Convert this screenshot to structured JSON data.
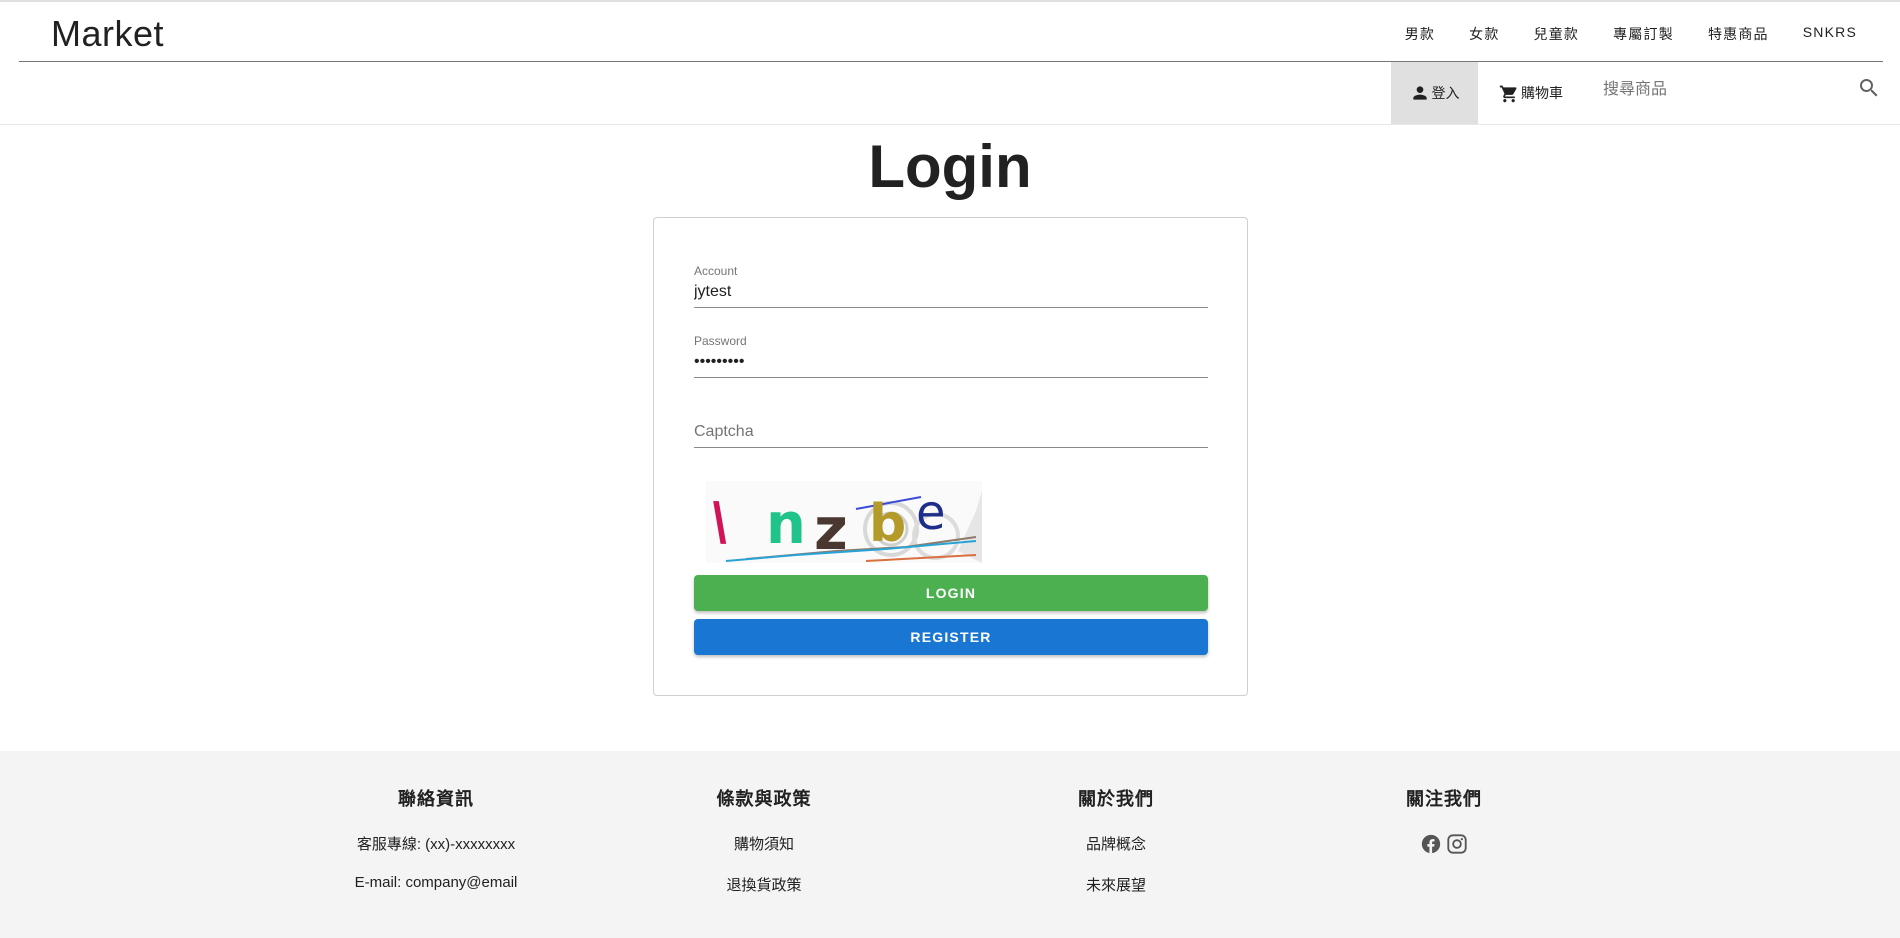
{
  "header": {
    "brand": "Market",
    "nav": [
      "男款",
      "女款",
      "兒童款",
      "專屬訂製",
      "特惠商品",
      "SNKRS"
    ]
  },
  "subbar": {
    "login_label": "登入",
    "cart_label": "購物車",
    "search_placeholder": "搜尋商品"
  },
  "page": {
    "title": "Login"
  },
  "form": {
    "account_label": "Account",
    "account_value": "jytest",
    "password_label": "Password",
    "password_value": "jytest123",
    "captcha_placeholder": "Captcha",
    "captcha_text": "Vnzbe",
    "login_button": "LOGIN",
    "register_button": "REGISTER"
  },
  "footer": {
    "contact": {
      "title": "聯絡資訊",
      "items": [
        "客服專線: (xx)-xxxxxxxx",
        "E-mail: company@email"
      ]
    },
    "policy": {
      "title": "條款與政策",
      "items": [
        "購物須知",
        "退換貨政策"
      ]
    },
    "about": {
      "title": "關於我們",
      "items": [
        "品牌概念",
        "未來展望"
      ]
    },
    "follow": {
      "title": "關注我們",
      "icons": [
        "facebook-icon",
        "instagram-icon"
      ]
    }
  },
  "colors": {
    "login_button": "#4caf50",
    "register_button": "#1976d2",
    "footer_bg": "#f4f4f4",
    "active_tab_bg": "#e0e0e0"
  }
}
